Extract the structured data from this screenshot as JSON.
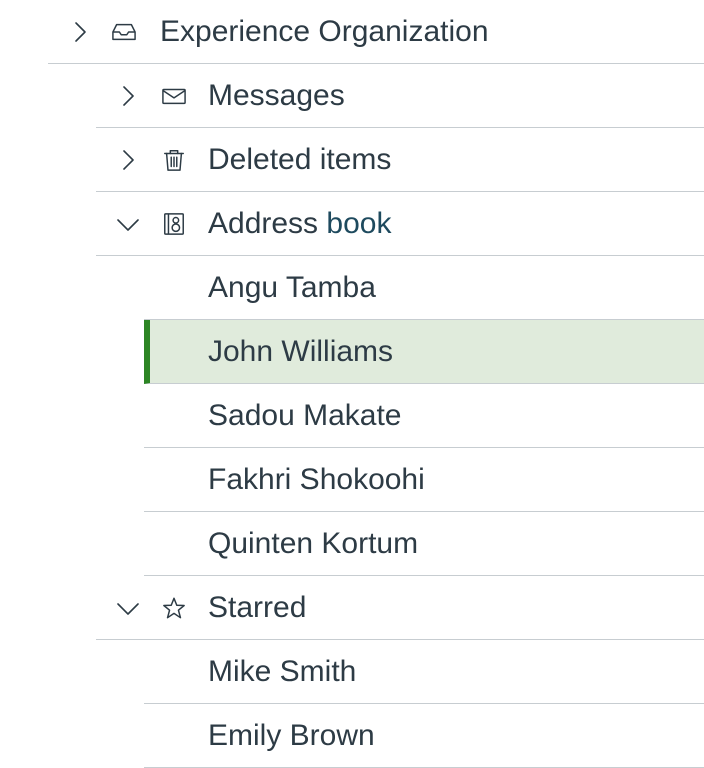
{
  "tree": {
    "root": {
      "label": "Experience Organization",
      "expanded": false,
      "icon": "inbox-icon"
    },
    "folders": [
      {
        "label": "Messages",
        "expanded": false,
        "icon": "envelope-icon"
      },
      {
        "label": "Deleted items",
        "expanded": false,
        "icon": "trash-icon"
      },
      {
        "label_main": "Address ",
        "label_accent": "book",
        "expanded": true,
        "icon": "address-book-icon",
        "contacts": [
          {
            "name": "Angu Tamba",
            "selected": false
          },
          {
            "name": "John Williams",
            "selected": true
          },
          {
            "name": "Sadou Makate",
            "selected": false
          },
          {
            "name": "Fakhri Shokoohi",
            "selected": false
          },
          {
            "name": "Quinten Kortum",
            "selected": false
          }
        ]
      },
      {
        "label": "Starred",
        "expanded": true,
        "icon": "star-icon",
        "contacts": [
          {
            "name": "Mike Smith",
            "selected": false
          },
          {
            "name": "Emily Brown",
            "selected": false
          }
        ]
      }
    ]
  },
  "colors": {
    "text": "#2d3b45",
    "divider": "#c7cdd1",
    "selected_bg": "#e0ebdc",
    "selected_bar": "#2c8524"
  }
}
